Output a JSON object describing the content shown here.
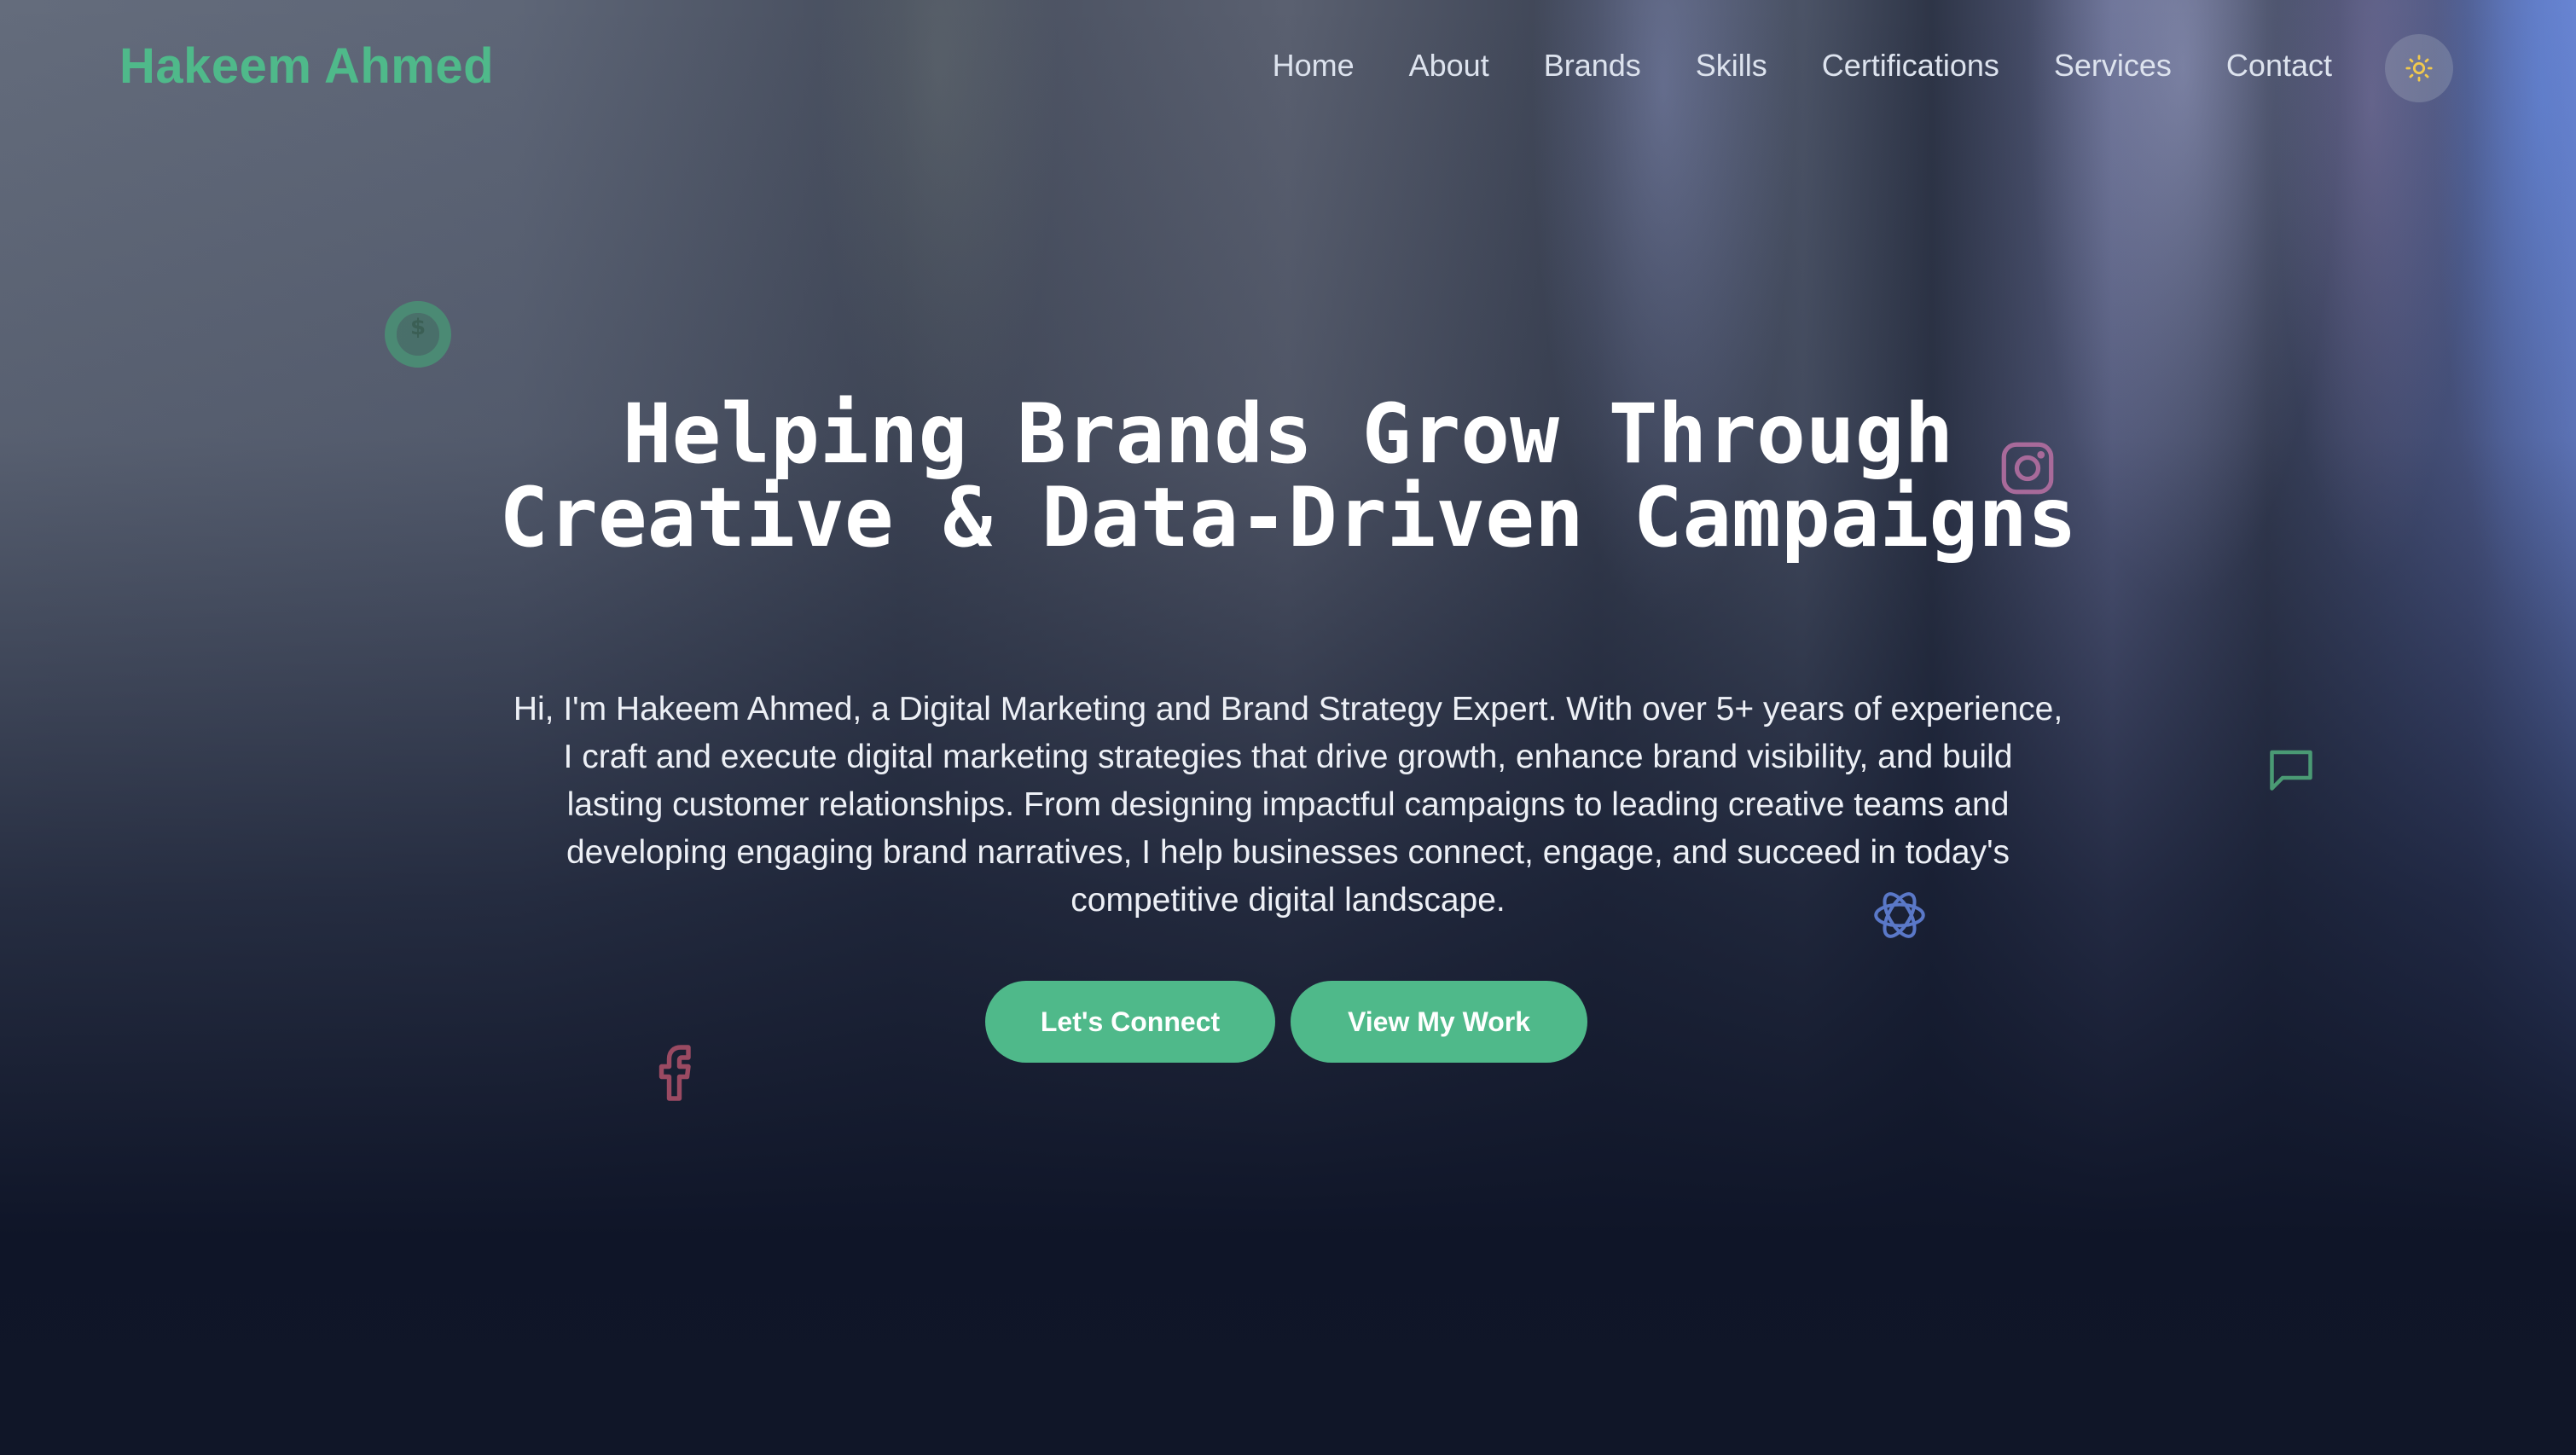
{
  "header": {
    "brand": "Hakeem Ahmed",
    "nav": [
      "Home",
      "About",
      "Brands",
      "Skills",
      "Certifications",
      "Services",
      "Contact"
    ],
    "theme_toggle_icon": "sun-icon"
  },
  "hero": {
    "title": "Helping Brands Grow Through Creative & Data-Driven Campaigns",
    "text": "Hi, I'm Hakeem Ahmed, a Digital Marketing and Brand Strategy Expert. With over 5+ years of experience, I craft and execute digital marketing strategies that drive growth, enhance brand visibility, and build lasting customer relationships. From designing impactful campaigns to leading creative teams and developing engaging brand narratives, I help businesses connect, engage, and succeed in today's competitive digital landscape.",
    "primary_button": "Let's Connect",
    "secondary_button": "View My Work"
  },
  "floating_icons": [
    "dollar-icon",
    "instagram-icon",
    "chat-icon",
    "openai-icon",
    "facebook-icon"
  ],
  "colors": {
    "accent": "#4fb98a",
    "instagram": "#a86a9a",
    "facebook": "#9a4a62",
    "openai": "#5a78c8",
    "sun": "#f2c94c"
  }
}
